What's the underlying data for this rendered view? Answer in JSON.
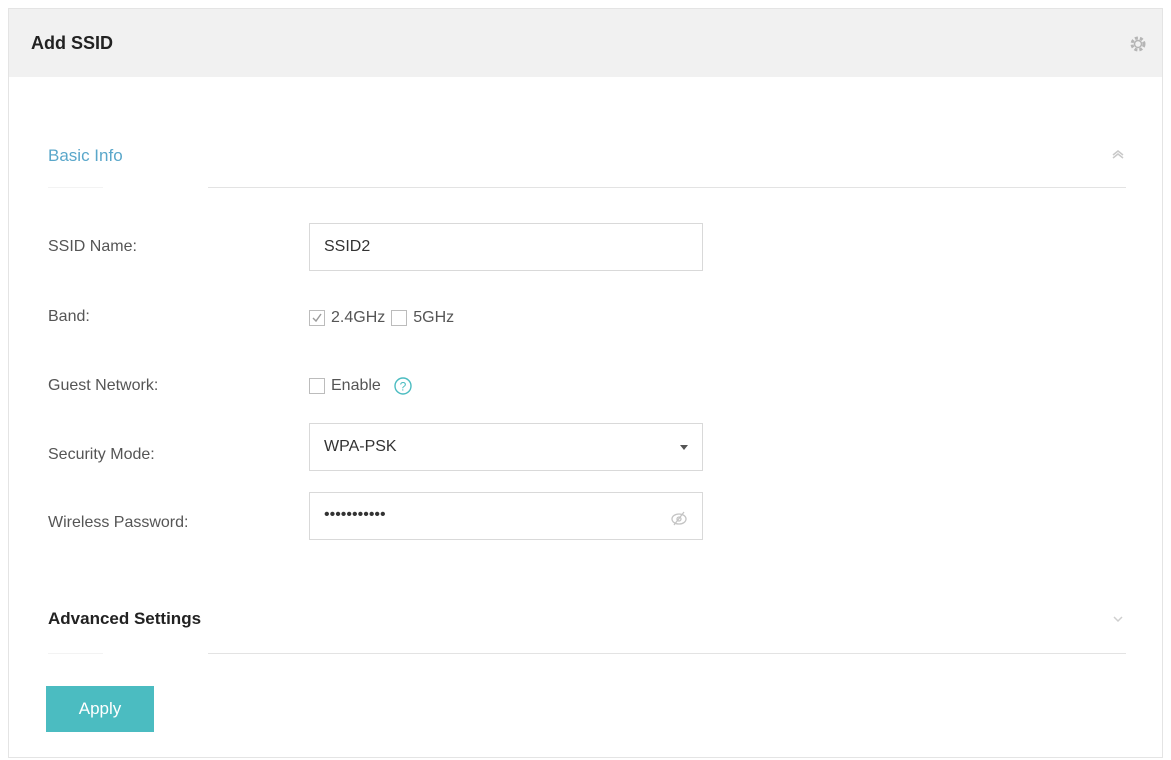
{
  "panel": {
    "title": "Add SSID",
    "settings_icon": "gear-icon"
  },
  "basic_info": {
    "title": "Basic Info",
    "collapse_icon": "chevron-up-icon"
  },
  "form": {
    "ssid_name": {
      "label": "SSID Name:",
      "value": "SSID2"
    },
    "band": {
      "label": "Band:",
      "options": [
        {
          "label": "2.4GHz",
          "checked": true
        },
        {
          "label": "5GHz",
          "checked": false
        }
      ]
    },
    "guest_network": {
      "label": "Guest Network:",
      "option_label": "Enable",
      "checked": false,
      "help_icon": "question-circle-icon"
    },
    "security_mode": {
      "label": "Security Mode:",
      "value": "WPA-PSK",
      "icon": "caret-down-icon"
    },
    "wireless_password": {
      "label": "Wireless Password:",
      "value": "•••••••••••",
      "icon": "eye-off-icon"
    }
  },
  "advanced": {
    "title": "Advanced Settings",
    "expand_icon": "chevron-down-icon"
  },
  "apply_button": {
    "label": "Apply"
  },
  "colors": {
    "accent": "#4bbcc1",
    "header_bg": "#f1f1f1",
    "section_title_accent": "#5aa7ca"
  }
}
